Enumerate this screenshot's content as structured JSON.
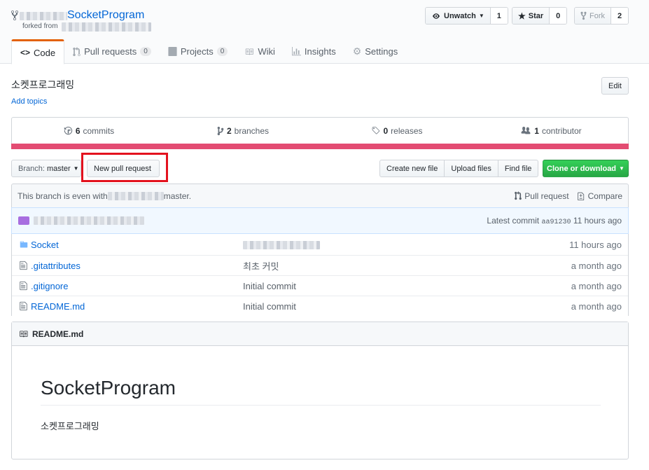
{
  "repo": {
    "name": "SocketProgram",
    "forked_label": "forked from"
  },
  "actions": {
    "watch_label": "Unwatch",
    "watch_count": "1",
    "star_label": "Star",
    "star_count": "0",
    "fork_label": "Fork",
    "fork_count": "2"
  },
  "tabs": [
    {
      "label": "Code"
    },
    {
      "label": "Pull requests",
      "count": "0"
    },
    {
      "label": "Projects",
      "count": "0"
    },
    {
      "label": "Wiki"
    },
    {
      "label": "Insights"
    },
    {
      "label": "Settings"
    }
  ],
  "description": "소켓프로그래밍",
  "add_topics": "Add topics",
  "edit_label": "Edit",
  "summary": {
    "commits_num": "6",
    "commits_label": "commits",
    "branches_num": "2",
    "branches_label": "branches",
    "releases_num": "0",
    "releases_label": "releases",
    "contributors_num": "1",
    "contributors_label": "contributor"
  },
  "language_color": "#e34c72",
  "file_nav": {
    "branch_prefix": "Branch:",
    "branch_name": "master",
    "new_pr": "New pull request",
    "create_file": "Create new file",
    "upload_files": "Upload files",
    "find_file": "Find file",
    "clone": "Clone or download"
  },
  "branch_info": {
    "text_before": "This branch is even with",
    "text_after": "master.",
    "pull_request": "Pull request",
    "compare": "Compare"
  },
  "latest_commit": {
    "label": "Latest commit",
    "sha": "aa91230",
    "age": "11 hours ago"
  },
  "files": [
    {
      "type": "dir",
      "name": "Socket",
      "message": "",
      "age": "11 hours ago"
    },
    {
      "type": "file",
      "name": ".gitattributes",
      "message": "최초 커밋",
      "age": "a month ago"
    },
    {
      "type": "file",
      "name": ".gitignore",
      "message": "Initial commit",
      "age": "a month ago"
    },
    {
      "type": "file",
      "name": "README.md",
      "message": "Initial commit",
      "age": "a month ago"
    }
  ],
  "readme": {
    "filename": "README.md",
    "title": "SocketProgram",
    "body": "소켓프로그래밍"
  }
}
